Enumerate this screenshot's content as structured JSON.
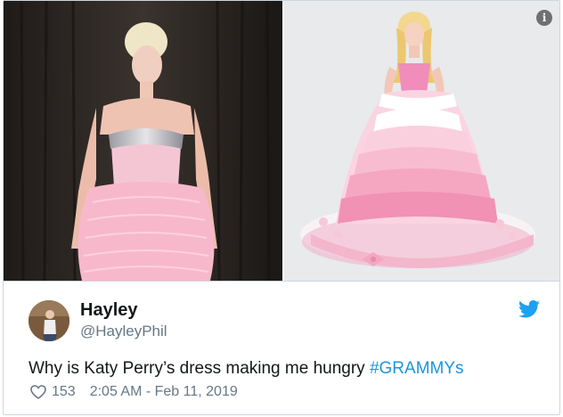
{
  "tweet": {
    "author": {
      "display_name": "Hayley",
      "screen_name": "@HayleyPhil",
      "avatar_icon": "avatar-photo"
    },
    "text_main": "Why is Katy Perry’s dress making me hungry ",
    "hashtag": "#GRAMMYs",
    "likes": "153",
    "timestamp": "2:05 AM - Feb 11, 2019",
    "icons": {
      "like": "heart-icon",
      "brand": "twitter-bird-icon",
      "info": "info-icon"
    },
    "colors": {
      "brand": "#1da1f2",
      "hashtag": "#1b95e0",
      "secondary_text": "#657786",
      "border": "#ccd6dd"
    },
    "media": {
      "photos": [
        "katy-perry-pink-gown-photo",
        "barbie-doll-ruffle-cake-photo"
      ],
      "info_glyph": "i"
    }
  }
}
